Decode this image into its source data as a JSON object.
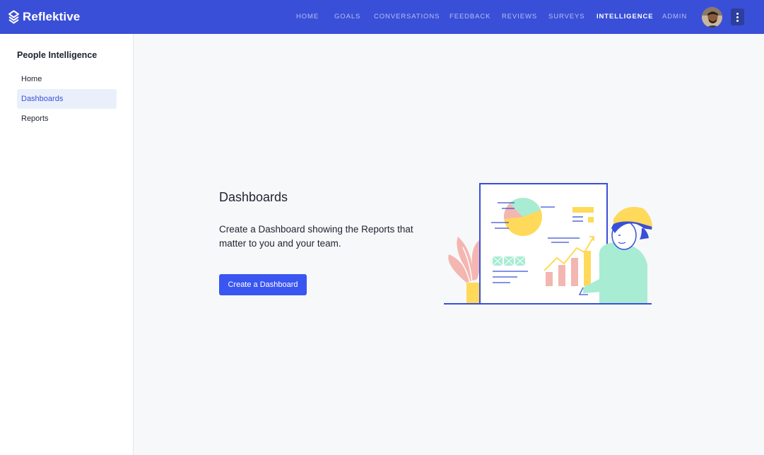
{
  "topbar": {
    "brand_name": "Reflektive",
    "nav": [
      {
        "label": "HOME"
      },
      {
        "label": "GOALS"
      },
      {
        "label": "CONVERSATIONS"
      },
      {
        "label": "FEEDBACK"
      },
      {
        "label": "REVIEWS"
      },
      {
        "label": "SURVEYS"
      },
      {
        "label": "INTELLIGENCE",
        "active": true
      },
      {
        "label": "ADMIN"
      }
    ]
  },
  "sidebar": {
    "title": "People Intelligence",
    "items": [
      {
        "label": "Home"
      },
      {
        "label": "Dashboards",
        "active": true
      },
      {
        "label": "Reports"
      }
    ]
  },
  "main": {
    "title": "Dashboards",
    "description": "Create a Dashboard showing the Reports that matter to you and your team.",
    "create_button": "Create a Dashboard"
  },
  "colors": {
    "topbar": "#3a4fd7",
    "accent": "#3a56f0",
    "active_bg": "#eaf0fb"
  },
  "icons": {
    "logo": "reflektive-logo-icon",
    "menu": "more-vertical-icon"
  }
}
